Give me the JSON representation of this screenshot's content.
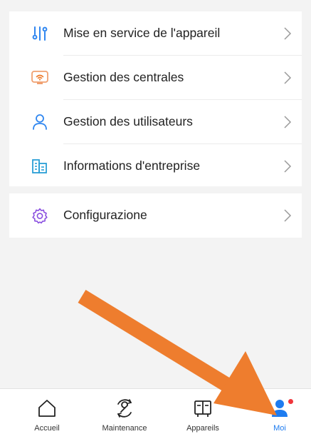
{
  "colors": {
    "accent": "#1e7cf0",
    "badge": "#f0353b",
    "arrow": "#ee7d2e"
  },
  "menu": {
    "group1": [
      {
        "label": "Mise en service de l'appareil",
        "icon": "sliders-icon"
      },
      {
        "label": "Gestion des centrales",
        "icon": "wifi-panel-icon"
      },
      {
        "label": "Gestion des utilisateurs",
        "icon": "user-icon"
      },
      {
        "label": "Informations d'entreprise",
        "icon": "building-icon"
      }
    ],
    "group2": [
      {
        "label": "Configurazione",
        "icon": "gear-icon"
      }
    ]
  },
  "tabbar": {
    "tabs": [
      {
        "label": "Accueil",
        "icon": "home-icon"
      },
      {
        "label": "Maintenance",
        "icon": "wrench-icon"
      },
      {
        "label": "Appareils",
        "icon": "devices-icon"
      },
      {
        "label": "Moi",
        "icon": "person-icon",
        "active": true,
        "badge": true
      }
    ]
  },
  "overlay": {
    "arrow": "annotation-arrow-pointing-to-moi-tab"
  }
}
